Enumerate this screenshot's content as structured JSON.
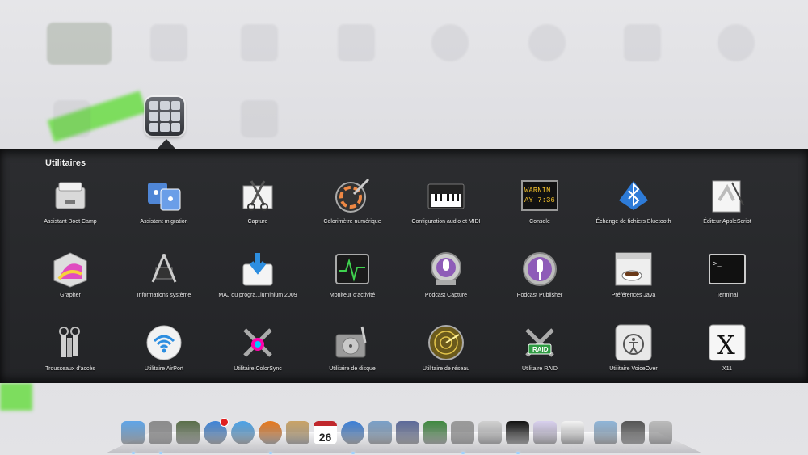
{
  "folder": {
    "title": "Utilitaires"
  },
  "apps": [
    {
      "label": "Assistant Boot Camp",
      "icon": "boot-camp-icon"
    },
    {
      "label": "Assistant migration",
      "icon": "migration-assistant-icon"
    },
    {
      "label": "Capture",
      "icon": "grab-scissors-icon"
    },
    {
      "label": "Colorimètre numérique",
      "icon": "digital-color-meter-icon"
    },
    {
      "label": "Configuration audio et MIDI",
      "icon": "audio-midi-keyboard-icon"
    },
    {
      "label": "Console",
      "icon": "console-warning-icon"
    },
    {
      "label": "Échange de fichiers Bluetooth",
      "icon": "bluetooth-icon"
    },
    {
      "label": "Éditeur AppleScript",
      "icon": "applescript-icon"
    },
    {
      "label": "Grapher",
      "icon": "grapher-icon"
    },
    {
      "label": "Informations système",
      "icon": "system-information-icon"
    },
    {
      "label": "MAJ du progra...luminium 2009",
      "icon": "firmware-update-icon"
    },
    {
      "label": "Moniteur d'activité",
      "icon": "activity-monitor-icon"
    },
    {
      "label": "Podcast Capture",
      "icon": "podcast-capture-icon"
    },
    {
      "label": "Podcast Publisher",
      "icon": "podcast-publisher-icon"
    },
    {
      "label": "Préférences Java",
      "icon": "java-coffee-icon"
    },
    {
      "label": "Terminal",
      "icon": "terminal-icon"
    },
    {
      "label": "Trousseaux d'accès",
      "icon": "keychain-icon"
    },
    {
      "label": "Utilitaire AirPort",
      "icon": "airport-wifi-icon"
    },
    {
      "label": "Utilitaire ColorSync",
      "icon": "colorsync-icon"
    },
    {
      "label": "Utilitaire de disque",
      "icon": "disk-utility-icon"
    },
    {
      "label": "Utilitaire de réseau",
      "icon": "network-radar-icon"
    },
    {
      "label": "Utilitaire RAID",
      "icon": "raid-icon"
    },
    {
      "label": "Utilitaire VoiceOver",
      "icon": "voiceover-icon"
    },
    {
      "label": "X11",
      "icon": "x11-icon"
    }
  ],
  "icon_text": {
    "console": "WARNIN\nAY 7:36",
    "raid": "RAID",
    "x11": "X",
    "terminal": ">_"
  },
  "dock": {
    "items": [
      {
        "icon": "finder-icon",
        "running": true
      },
      {
        "icon": "launchpad-rocket-icon",
        "running": true
      },
      {
        "icon": "dashboard-icon",
        "running": false
      },
      {
        "icon": "app-store-icon",
        "running": false,
        "badge": true
      },
      {
        "icon": "safari-compass-icon",
        "running": false
      },
      {
        "icon": "firefox-icon",
        "running": true
      },
      {
        "icon": "address-book-icon",
        "running": false
      },
      {
        "icon": "ical-icon",
        "running": false,
        "text": "26"
      },
      {
        "icon": "itunes-icon",
        "running": true
      },
      {
        "icon": "iphoto-icon",
        "running": false
      },
      {
        "icon": "quill-icon",
        "running": false
      },
      {
        "icon": "numbers-chart-icon",
        "running": false
      },
      {
        "icon": "system-preferences-icon",
        "running": true
      },
      {
        "icon": "grab-icon",
        "running": false
      },
      {
        "icon": "terminal-icon",
        "running": true
      },
      {
        "icon": "automator-icon",
        "running": false
      },
      {
        "icon": "textedit-icon",
        "running": false
      },
      {
        "icon": "applications-folder-icon",
        "running": false
      },
      {
        "icon": "documents-stack-icon",
        "running": false
      },
      {
        "icon": "trash-icon",
        "running": false
      }
    ]
  },
  "colors": {
    "panel": "#26272a",
    "label": "#f0f0f0",
    "dock_dot": "#9fd1ff"
  }
}
